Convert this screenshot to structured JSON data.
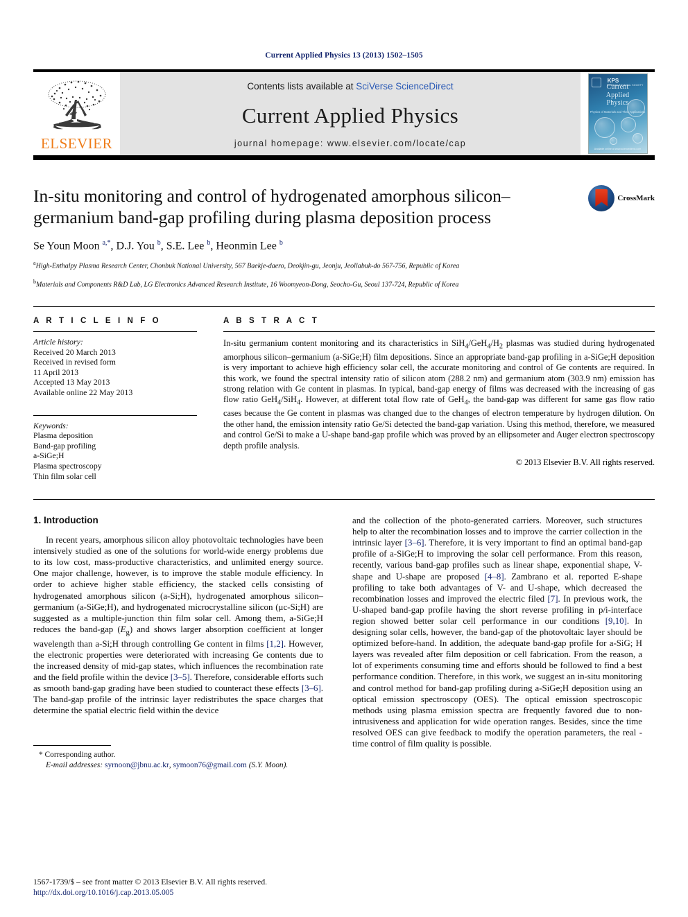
{
  "running_head": "Current Applied Physics 13 (2013) 1502–1505",
  "masthead": {
    "publisher_name": "ELSEVIER",
    "contents_prefix": "Contents lists available at ",
    "contents_link": "SciVerse ScienceDirect",
    "journal_title": "Current Applied Physics",
    "homepage": "journal homepage: www.elsevier.com/locate/cap",
    "cover": {
      "title_line1": "Current",
      "title_line2": "Applied",
      "title_line3": "Physics",
      "subtitle": "Physics of Materials and Their Applications",
      "society_mark": "KPS",
      "society_sub": "KOREAN PHYSICAL SOCIETY",
      "footer": "Available online at www.sciencedirect.com"
    }
  },
  "article": {
    "title": "In-situ monitoring and control of hydrogenated amorphous silicon–germanium band-gap profiling during plasma deposition process",
    "authors_html": "Se Youn Moon <sup>a,*</sup>, D.J. You <sup>b</sup>, S.E. Lee <sup>b</sup>, Heonmin Lee <sup>b</sup>",
    "affiliation_a": "High-Enthalpy Plasma Research Center, Chonbuk National University, 567 Baekje-daero, Deokjin-gu, Jeonju, Jeollabuk-do 567-756, Republic of Korea",
    "affiliation_b": "Materials and Components R&D Lab, LG Electronics Advanced Research Institute, 16 Woomyeon-Dong, Seocho-Gu, Seoul 137-724, Republic of Korea",
    "crossmark_label": "CrossMark"
  },
  "article_info": {
    "heading": "A R T I C L E    I N F O",
    "history_label": "Article history:",
    "history": [
      "Received 20 March 2013",
      "Received in revised form",
      "11 April 2013",
      "Accepted 13 May 2013",
      "Available online 22 May 2013"
    ],
    "keywords_label": "Keywords:",
    "keywords": [
      "Plasma deposition",
      "Band-gap profiling",
      "a-SiGe;H",
      "Plasma spectroscopy",
      "Thin film solar cell"
    ]
  },
  "abstract": {
    "heading": "A B S T R A C T",
    "text": "In-situ germanium content monitoring and its characteristics in SiH4/GeH4/H2 plasmas was studied during hydrogenated amorphous silicon–germanium (a-SiGe;H) film depositions. Since an appropriate band-gap profiling in a-SiGe;H deposition is very important to achieve high efficiency solar cell, the accurate monitoring and control of Ge contents are required. In this work, we found the spectral intensity ratio of silicon atom (288.2 nm) and germanium atom (303.9 nm) emission has strong relation with Ge content in plasmas. In typical, band-gap energy of films was decreased with the increasing of gas flow ratio GeH4/SiH4. However, at different total flow rate of GeH4, the band-gap was different for same gas flow ratio cases because the Ge content in plasmas was changed due to the changes of electron temperature by hydrogen dilution. On the other hand, the emission intensity ratio Ge/Si detected the band-gap variation. Using this method, therefore, we measured and control Ge/Si to make a U-shape band-gap profile which was proved by an ellipsometer and Auger electron spectroscopy depth profile analysis.",
    "copyright": "© 2013 Elsevier B.V. All rights reserved."
  },
  "body": {
    "section_heading": "1.  Introduction",
    "left_paragraph": "In recent years, amorphous silicon alloy photovoltaic technologies have been intensively studied as one of the solutions for world-wide energy problems due to its low cost, mass-productive characteristics, and unlimited energy source. One major challenge, however, is to improve the stable module efficiency. In order to achieve higher stable efficiency, the stacked cells consisting of hydrogenated amorphous silicon (a-Si;H), hydrogenated amorphous silicon–germanium (a-SiGe;H), and hydrogenated microcrystalline silicon (μc-Si;H) are suggested as a multiple-junction thin film solar cell. Among them, a-SiGe;H reduces the band-gap (Eg) and shows larger absorption coefficient at longer wavelength than a-Si;H through controlling Ge content in films [1,2]. However, the electronic properties were deteriorated with increasing Ge contents due to the increased density of mid-gap states, which influences the recombination rate and the field profile within the device [3–5]. Therefore, considerable efforts such as smooth band-gap grading have been studied to counteract these effects [3–6]. The band-gap profile of the intrinsic layer redistributes the space charges that determine the spatial electric field within the device",
    "right_paragraph": "and the collection of the photo-generated carriers. Moreover, such structures help to alter the recombination losses and to improve the carrier collection in the intrinsic layer [3–6]. Therefore, it is very important to find an optimal band-gap profile of a-SiGe;H to improving the solar cell performance. From this reason, recently, various band-gap profiles such as linear shape, exponential shape, V-shape and U-shape are proposed [4–8]. Zambrano et al. reported E-shape profiling to take both advantages of V- and U-shape, which decreased the recombination losses and improved the electric filed [7]. In previous work, the U-shaped band-gap profile having the short reverse profiling in p/i-interface region showed better solar cell performance in our conditions [9,10]. In designing solar cells, however, the band-gap of the photovoltaic layer should be optimized before-hand. In addition, the adequate band-gap profile for a-SiG; H layers was revealed after film deposition or cell fabrication. From the reason, a lot of experiments consuming time and efforts should be followed to find a best performance condition. Therefore, in this work, we suggest an in-situ monitoring and control method for band-gap profiling during a-SiGe;H deposition using an optical emission spectroscopy (OES). The optical emission spectroscopic methods using plasma emission spectra are frequently favored due to non-intrusiveness and application for wide operation ranges. Besides, since the time resolved OES can give feedback to modify the operation parameters, the real -time control of film quality is possible."
  },
  "footnote": {
    "corresponding": "* Corresponding author.",
    "email_label": "E-mail addresses:",
    "email1": "syrnoon@jbnu.ac.kr",
    "email2": "symoon76@gmail.com",
    "email_suffix": "(S.Y. Moon)."
  },
  "page_footer": {
    "issn_line": "1567-1739/$ – see front matter © 2013 Elsevier B.V. All rights reserved.",
    "doi": "http://dx.doi.org/10.1016/j.cap.2013.05.005"
  },
  "colors": {
    "link_blue": "#15266e",
    "sciencedirect_blue": "#2a59b5",
    "elsevier_orange": "#ef7d1a",
    "band_gray": "#e3e3e3"
  }
}
